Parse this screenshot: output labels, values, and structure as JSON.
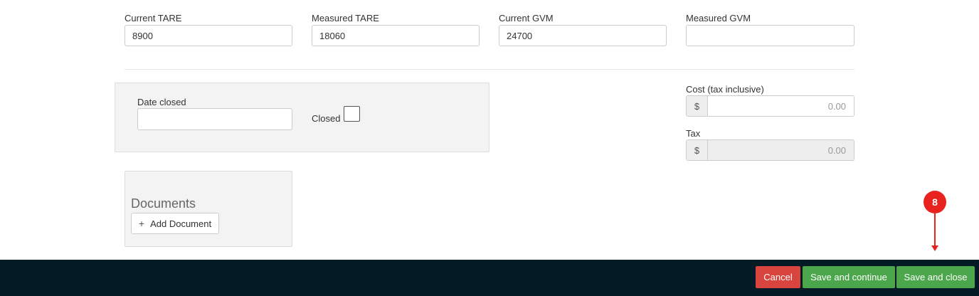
{
  "weights": {
    "current_tare": {
      "label": "Current TARE",
      "value": "8900"
    },
    "measured_tare": {
      "label": "Measured TARE",
      "value": "18060"
    },
    "current_gvm": {
      "label": "Current GVM",
      "value": "24700"
    },
    "measured_gvm": {
      "label": "Measured GVM",
      "value": ""
    }
  },
  "closing": {
    "date_closed_label": "Date closed",
    "date_closed_value": "",
    "closed_label": "Closed",
    "closed_checked": false
  },
  "cost": {
    "label": "Cost (tax inclusive)",
    "currency": "$",
    "value": "0.00"
  },
  "tax": {
    "label": "Tax",
    "currency": "$",
    "value": "0.00"
  },
  "documents": {
    "title": "Documents",
    "add_button_label": "Add Document",
    "add_icon": "+"
  },
  "annotation": {
    "step_number": "8",
    "color": "#e8231d"
  },
  "footer": {
    "cancel_label": "Cancel",
    "save_continue_label": "Save and continue",
    "save_close_label": "Save and close",
    "background_color": "#041b26",
    "cancel_color": "#d9443e",
    "save_color": "#4ca64c"
  }
}
